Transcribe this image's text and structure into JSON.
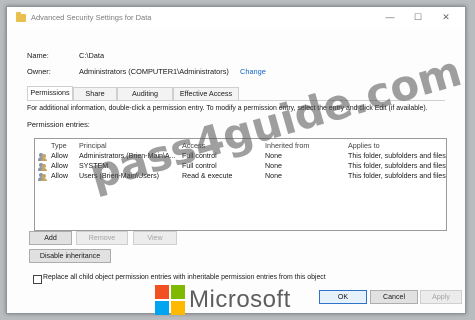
{
  "window": {
    "title": "Advanced Security Settings for Data",
    "minimize_glyph": "—",
    "maximize_glyph": "☐",
    "close_glyph": "✕"
  },
  "info": {
    "name_label": "Name:",
    "name_value": "C:\\Data",
    "owner_label": "Owner:",
    "owner_value": "Administrators (COMPUTER1\\Administrators)",
    "change_link": "Change"
  },
  "tabs": [
    {
      "label": "Permissions",
      "active": true
    },
    {
      "label": "Share",
      "active": false
    },
    {
      "label": "Auditing",
      "active": false
    },
    {
      "label": "Effective Access",
      "active": false
    }
  ],
  "instructions": "For additional information, double-click a permission entry. To modify a permission entry, select the entry and click Edit (if available).",
  "entries_label": "Permission entries:",
  "columns": [
    "Type",
    "Principal",
    "Access",
    "Inherited from",
    "Applies to"
  ],
  "rows": [
    {
      "type": "Allow",
      "principal": "Administrators (Brien-Main\\A...",
      "access": "Full control",
      "inherited": "None",
      "applies": "This folder, subfolders and files"
    },
    {
      "type": "Allow",
      "principal": "SYSTEM",
      "access": "Full control",
      "inherited": "None",
      "applies": "This folder, subfolders and files"
    },
    {
      "type": "Allow",
      "principal": "Users (Brien-Main\\Users)",
      "access": "Read & execute",
      "inherited": "None",
      "applies": "This folder, subfolders and files"
    }
  ],
  "buttons": {
    "add": "Add",
    "remove": "Remove",
    "view": "View",
    "disable_inheritance": "Disable inheritance",
    "ok": "OK",
    "cancel": "Cancel",
    "apply": "Apply"
  },
  "checkbox_label": "Replace all child object permission entries with inheritable permission entries from this object",
  "overlay": {
    "watermark": "pass4guide.com",
    "brand_text": "Microsoft",
    "brand_colors": [
      "#f25022",
      "#7fba00",
      "#00a4ef",
      "#ffb900"
    ]
  }
}
